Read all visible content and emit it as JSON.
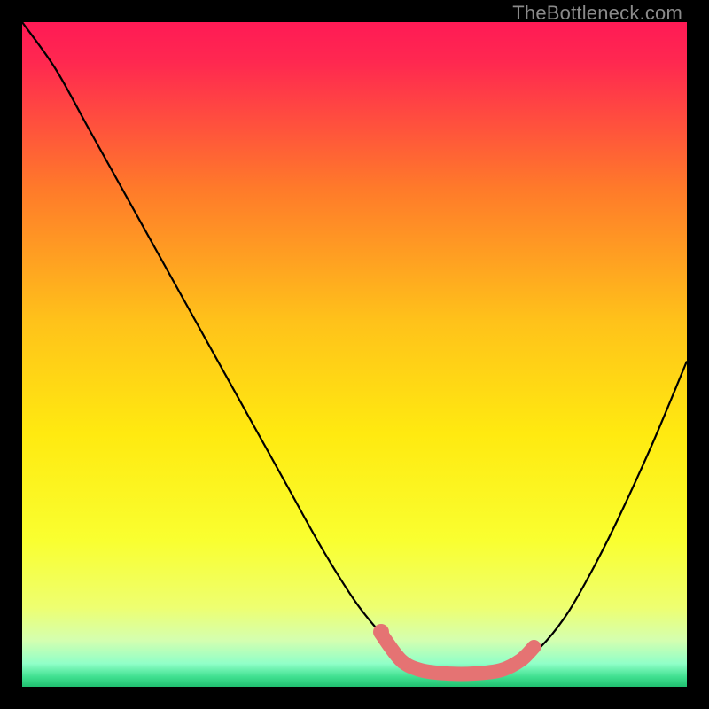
{
  "watermark": "TheBottleneck.com",
  "accent_color": "#e57373",
  "curve_color": "#000000",
  "chart_data": {
    "type": "line",
    "title": "",
    "xlabel": "",
    "ylabel": "",
    "xlim": [
      0,
      100
    ],
    "ylim": [
      0,
      100
    ],
    "grid": false,
    "legend": false,
    "background": "gradient",
    "series": [
      {
        "name": "bottleneck-curve",
        "x": [
          0,
          5,
          10,
          15,
          20,
          25,
          30,
          35,
          40,
          45,
          50,
          54,
          58,
          62,
          66,
          70,
          74,
          78,
          82,
          86,
          90,
          95,
          100
        ],
        "y": [
          100,
          93,
          84,
          75,
          66,
          57,
          48,
          39,
          30,
          21,
          13,
          8,
          4,
          2,
          2,
          2,
          3,
          6,
          11,
          18,
          26,
          37,
          49
        ]
      }
    ],
    "highlight": {
      "name": "ideal-match-region",
      "color": "#e57373",
      "x": [
        54,
        57,
        60,
        64,
        68,
        72,
        75,
        77
      ],
      "y": [
        8,
        4,
        2.5,
        2,
        2,
        2.5,
        4,
        6
      ]
    },
    "gradient_stops": [
      {
        "pos": 0.0,
        "color": "#ff1a55"
      },
      {
        "pos": 0.06,
        "color": "#ff2850"
      },
      {
        "pos": 0.25,
        "color": "#ff7a2a"
      },
      {
        "pos": 0.45,
        "color": "#ffc21a"
      },
      {
        "pos": 0.62,
        "color": "#ffea10"
      },
      {
        "pos": 0.78,
        "color": "#f9ff30"
      },
      {
        "pos": 0.88,
        "color": "#eeff70"
      },
      {
        "pos": 0.93,
        "color": "#d4ffb0"
      },
      {
        "pos": 0.965,
        "color": "#90ffc8"
      },
      {
        "pos": 0.985,
        "color": "#40e090"
      },
      {
        "pos": 1.0,
        "color": "#20c070"
      }
    ]
  }
}
